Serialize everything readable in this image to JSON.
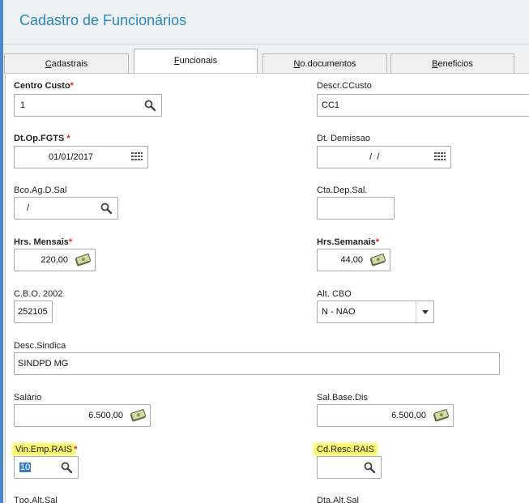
{
  "header": {
    "title": "Cadastro de Funcionários"
  },
  "tabs": [
    {
      "label": "Cadastrais",
      "mnemonic": "C",
      "rest": "adastrais"
    },
    {
      "label": "Funcionais",
      "mnemonic": "F",
      "rest": "uncionais",
      "active": true
    },
    {
      "label": "No.documentos",
      "mnemonic": "N",
      "rest": "o.documentos"
    },
    {
      "label": "Beneficios",
      "mnemonic": "B",
      "rest": "eneficios"
    }
  ],
  "form": {
    "centro_custo": {
      "label": "Centro Custo",
      "value": "1"
    },
    "descr_ccusto": {
      "label": "Descr.CCusto",
      "value": "CC1"
    },
    "dt_op_fgts": {
      "label": "Dt.Op.FGTS ",
      "value": "01/01/2017"
    },
    "dt_demissao": {
      "label": "Dt. Demissao",
      "value": "  /  /"
    },
    "bco_ag_d_sal": {
      "label": "Bco.Ag.D.Sal",
      "value": "/"
    },
    "cta_dep_sal": {
      "label": "Cta.Dep.Sal.",
      "value": ""
    },
    "hrs_mensais": {
      "label": "Hrs. Mensais",
      "value": "220,00"
    },
    "hrs_semanais": {
      "label": "Hrs.Semanais",
      "value": "44,00"
    },
    "cbo_2002": {
      "label": "C.B.O. 2002",
      "value": "252105"
    },
    "alt_cbo": {
      "label": "Alt. CBO",
      "value": "N - NAO"
    },
    "desc_sindica": {
      "label": "Desc.Sindica",
      "value": "SINDPD MG"
    },
    "salario": {
      "label": "Salário",
      "value": "6.500,00"
    },
    "sal_base_dis": {
      "label": "Sal.Base.Dis",
      "value": "6.500,00"
    },
    "vin_emp_rais": {
      "label": "Vin.Emp.RAIS",
      "value": "10"
    },
    "cd_resc_rais": {
      "label": "Cd.Resc.RAIS",
      "value": ""
    },
    "tpo_alt_sal": {
      "label": "Tpo.Alt.Sal"
    },
    "dta_alt_sal": {
      "label": "Dta.Alt.Sal"
    },
    "required_mark": "*"
  },
  "icons": {
    "search": "search-icon",
    "calendar": "calendar-icon",
    "money": "money-icon",
    "dropdown": "chevron-down-icon"
  },
  "colors": {
    "accent": "#2a88c0",
    "required": "#e02020",
    "highlight": "#f6f46a",
    "selection": "#3b7fc2"
  }
}
